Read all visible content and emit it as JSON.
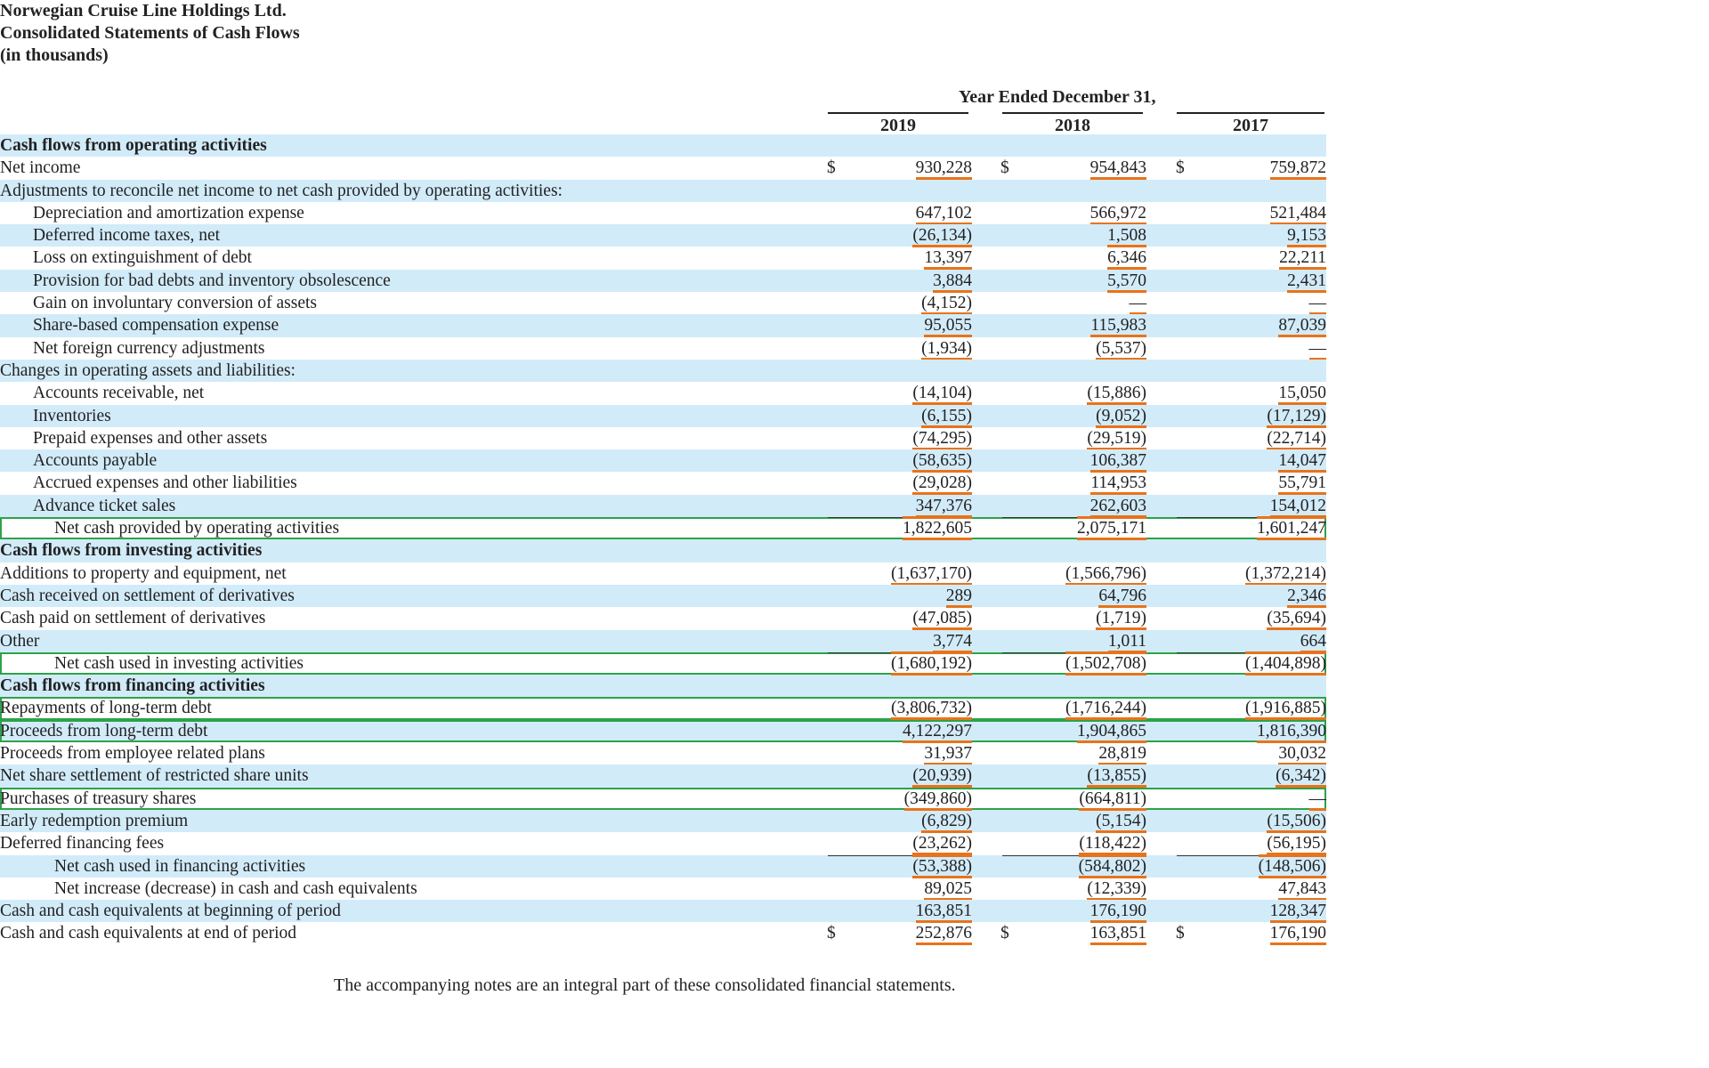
{
  "header": {
    "company": "Norwegian Cruise Line Holdings Ltd.",
    "statement": "Consolidated Statements of Cash Flows",
    "units": "(in thousands)"
  },
  "columns": {
    "period_label": "Year Ended December 31,",
    "years": [
      "2019",
      "2018",
      "2017"
    ]
  },
  "rows": [
    {
      "label": "Cash flows from operating activities",
      "indent": 0,
      "bold": true,
      "values": [
        "",
        "",
        ""
      ]
    },
    {
      "label": "Net income",
      "indent": 0,
      "dollar": true,
      "values": [
        "930,228",
        "954,843",
        "759,872"
      ]
    },
    {
      "label": "Adjustments to reconcile net income to net cash provided by operating activities:",
      "indent": 0,
      "values": [
        "",
        "",
        ""
      ]
    },
    {
      "label": "Depreciation and amortization expense",
      "indent": 1,
      "values": [
        "647,102",
        "566,972",
        "521,484"
      ]
    },
    {
      "label": "Deferred income taxes, net",
      "indent": 1,
      "values": [
        "(26,134)",
        "1,508",
        "9,153"
      ]
    },
    {
      "label": "Loss on extinguishment of debt",
      "indent": 1,
      "values": [
        "13,397",
        "6,346",
        "22,211"
      ]
    },
    {
      "label": "Provision for bad debts and inventory obsolescence",
      "indent": 1,
      "values": [
        "3,884",
        "5,570",
        "2,431"
      ]
    },
    {
      "label": "Gain on involuntary conversion of assets",
      "indent": 1,
      "values": [
        "(4,152)",
        "—",
        "—"
      ]
    },
    {
      "label": "Share-based compensation expense",
      "indent": 1,
      "values": [
        "95,055",
        "115,983",
        "87,039"
      ]
    },
    {
      "label": "Net foreign currency adjustments",
      "indent": 1,
      "values": [
        "(1,934)",
        "(5,537)",
        "—"
      ]
    },
    {
      "label": "Changes in operating assets and liabilities:",
      "indent": 0,
      "values": [
        "",
        "",
        ""
      ]
    },
    {
      "label": "Accounts receivable, net",
      "indent": 1,
      "values": [
        "(14,104)",
        "(15,886)",
        "15,050"
      ]
    },
    {
      "label": "Inventories",
      "indent": 1,
      "values": [
        "(6,155)",
        "(9,052)",
        "(17,129)"
      ]
    },
    {
      "label": "Prepaid expenses and other assets",
      "indent": 1,
      "values": [
        "(74,295)",
        "(29,519)",
        "(22,714)"
      ]
    },
    {
      "label": "Accounts payable",
      "indent": 1,
      "values": [
        "(58,635)",
        "106,387",
        "14,047"
      ]
    },
    {
      "label": "Accrued expenses and other liabilities",
      "indent": 1,
      "values": [
        "(29,028)",
        "114,953",
        "55,791"
      ]
    },
    {
      "label": "Advance ticket sales",
      "indent": 1,
      "values": [
        "347,376",
        "262,603",
        "154,012"
      ]
    },
    {
      "label": "Net cash provided by operating activities",
      "indent": 2,
      "highlight": true,
      "total": true,
      "values": [
        "1,822,605",
        "2,075,171",
        "1,601,247"
      ]
    },
    {
      "label": "Cash flows from investing activities",
      "indent": 0,
      "bold": true,
      "values": [
        "",
        "",
        ""
      ]
    },
    {
      "label": "Additions to property and equipment, net",
      "indent": 0,
      "values": [
        "(1,637,170)",
        "(1,566,796)",
        "(1,372,214)"
      ]
    },
    {
      "label": "Cash received on settlement of derivatives",
      "indent": 0,
      "values": [
        "289",
        "64,796",
        "2,346"
      ]
    },
    {
      "label": "Cash paid on settlement of derivatives",
      "indent": 0,
      "values": [
        "(47,085)",
        "(1,719)",
        "(35,694)"
      ]
    },
    {
      "label": "Other",
      "indent": 0,
      "values": [
        "3,774",
        "1,011",
        "664"
      ]
    },
    {
      "label": "Net cash used in investing activities",
      "indent": 2,
      "highlight": true,
      "total": true,
      "values": [
        "(1,680,192)",
        "(1,502,708)",
        "(1,404,898)"
      ]
    },
    {
      "label": "Cash flows from financing activities",
      "indent": 0,
      "bold": true,
      "values": [
        "",
        "",
        ""
      ]
    },
    {
      "label": "Repayments of long-term debt",
      "indent": 0,
      "highlight": true,
      "values": [
        "(3,806,732)",
        "(1,716,244)",
        "(1,916,885)"
      ]
    },
    {
      "label": "Proceeds from long-term debt",
      "indent": 0,
      "highlight": true,
      "values": [
        "4,122,297",
        "1,904,865",
        "1,816,390"
      ]
    },
    {
      "label": "Proceeds from employee related plans",
      "indent": 0,
      "values": [
        "31,937",
        "28,819",
        "30,032"
      ]
    },
    {
      "label": "Net share settlement of restricted share units",
      "indent": 0,
      "values": [
        "(20,939)",
        "(13,855)",
        "(6,342)"
      ]
    },
    {
      "label": "Purchases of treasury shares",
      "indent": 0,
      "highlight": true,
      "values": [
        "(349,860)",
        "(664,811)",
        "—"
      ]
    },
    {
      "label": "Early redemption premium",
      "indent": 0,
      "values": [
        "(6,829)",
        "(5,154)",
        "(15,506)"
      ]
    },
    {
      "label": "Deferred financing fees",
      "indent": 0,
      "values": [
        "(23,262)",
        "(118,422)",
        "(56,195)"
      ]
    },
    {
      "label": "Net cash used in financing activities",
      "indent": 2,
      "total": true,
      "values": [
        "(53,388)",
        "(584,802)",
        "(148,506)"
      ]
    },
    {
      "label": "Net increase (decrease) in cash and cash equivalents",
      "indent": 2,
      "values": [
        "89,025",
        "(12,339)",
        "47,843"
      ]
    },
    {
      "label": "Cash and cash equivalents at beginning of period",
      "indent": 0,
      "values": [
        "163,851",
        "176,190",
        "128,347"
      ]
    },
    {
      "label": "Cash and cash equivalents at end of period",
      "indent": 0,
      "dollar": true,
      "values": [
        "252,876",
        "163,851",
        "176,190"
      ]
    }
  ],
  "dollar_sign": "$",
  "footnote": "The accompanying notes are an integral part of these consolidated financial statements.",
  "colors": {
    "row_stripe": "#d2ebf9",
    "value_underline": "#e8731a",
    "highlight_box": "#2ea24a"
  }
}
